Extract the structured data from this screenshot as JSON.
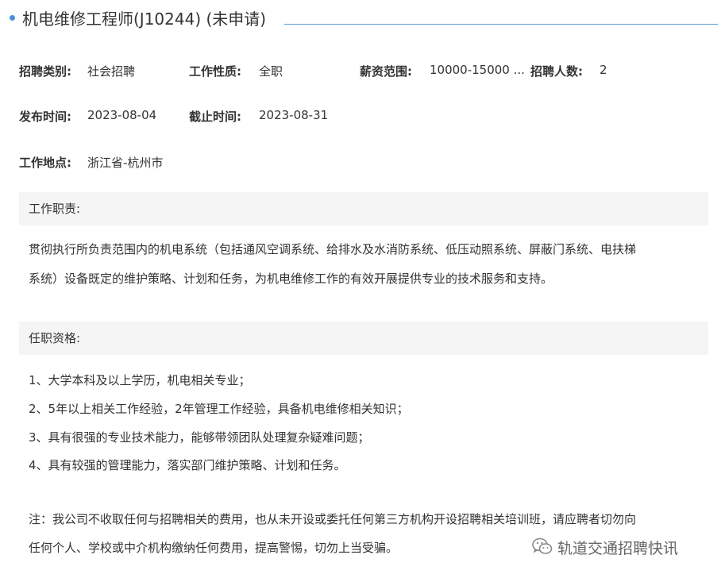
{
  "header": {
    "title": "机电维修工程师(J10244) (未申请)"
  },
  "job_meta": {
    "category_label": "招聘类别:",
    "category_value": "社会招聘",
    "nature_label": "工作性质:",
    "nature_value": "全职",
    "salary_label": "薪资范围:",
    "salary_value": "10000-15000 ...",
    "headcount_label": "招聘人数:",
    "headcount_value": "2",
    "publish_label": "发布时间:",
    "publish_value": "2023-08-04",
    "deadline_label": "截止时间:",
    "deadline_value": "2023-08-31",
    "location_label": "工作地点:",
    "location_value": "浙江省-杭州市"
  },
  "duties": {
    "heading": "工作职责:",
    "line1": "贯彻执行所负责范围内的机电系统（包括通风空调系统、给排水及水消防系统、低压动照系统、屏蔽门系统、电扶梯",
    "line2": "系统）设备既定的维护策略、计划和任务，为机电维修工作的有效开展提供专业的技术服务和支持。"
  },
  "qualifications": {
    "heading": "任职资格:",
    "items": [
      "1、大学本科及以上学历，机电相关专业；",
      "2、5年以上相关工作经验，2年管理工作经验，具备机电维修相关知识；",
      "3、具有很强的专业技术能力，能够带领团队处理复杂疑难问题；",
      "4、具有较强的管理能力，落实部门维护策略、计划和任务。"
    ]
  },
  "notice": {
    "line1": "注：我公司不收取任何与招聘相关的费用，也从未开设或委托任何第三方机构开设招聘相关培训班，请应聘者切勿向",
    "line2": "任何个人、学校或中介机构缴纳任何费用，提高警惕，切勿上当受骗。"
  },
  "watermark": {
    "icon": "wechat-icon",
    "text": "轨道交通招聘快讯"
  },
  "colors": {
    "accent": "#4a90d9",
    "section_bg": "#f5f5f5",
    "text": "#333333"
  }
}
